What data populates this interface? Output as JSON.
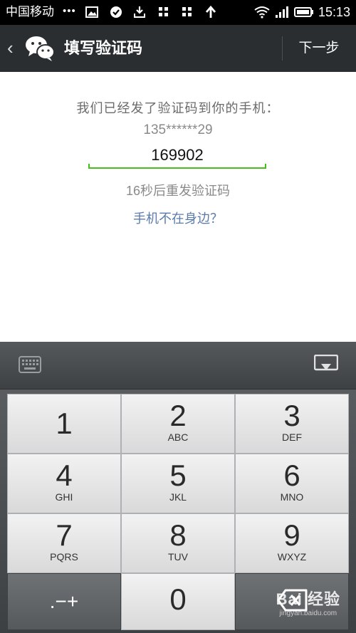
{
  "status_bar": {
    "carrier": "中国移动",
    "dots": "•••",
    "time": "15:13"
  },
  "header": {
    "back_label": "‹",
    "title": "填写验证码",
    "next_label": "下一步"
  },
  "content": {
    "message": "我们已经发了验证码到你的手机：",
    "phone": "135******29",
    "code_value": "169902",
    "resend_text": "16秒后重发验证码",
    "not_nearby_link": "手机不在身边？"
  },
  "keypad": {
    "keys": [
      {
        "num": "1",
        "letters": ""
      },
      {
        "num": "2",
        "letters": "ABC"
      },
      {
        "num": "3",
        "letters": "DEF"
      },
      {
        "num": "4",
        "letters": "GHI"
      },
      {
        "num": "5",
        "letters": "JKL"
      },
      {
        "num": "6",
        "letters": "MNO"
      },
      {
        "num": "7",
        "letters": "PQRS"
      },
      {
        "num": "8",
        "letters": "TUV"
      },
      {
        "num": "9",
        "letters": "WXYZ"
      }
    ],
    "symbols_label": ".−+",
    "zero": "0"
  },
  "watermark": {
    "brand": "Bai 经验",
    "url": "jingyan.baidu.com"
  }
}
